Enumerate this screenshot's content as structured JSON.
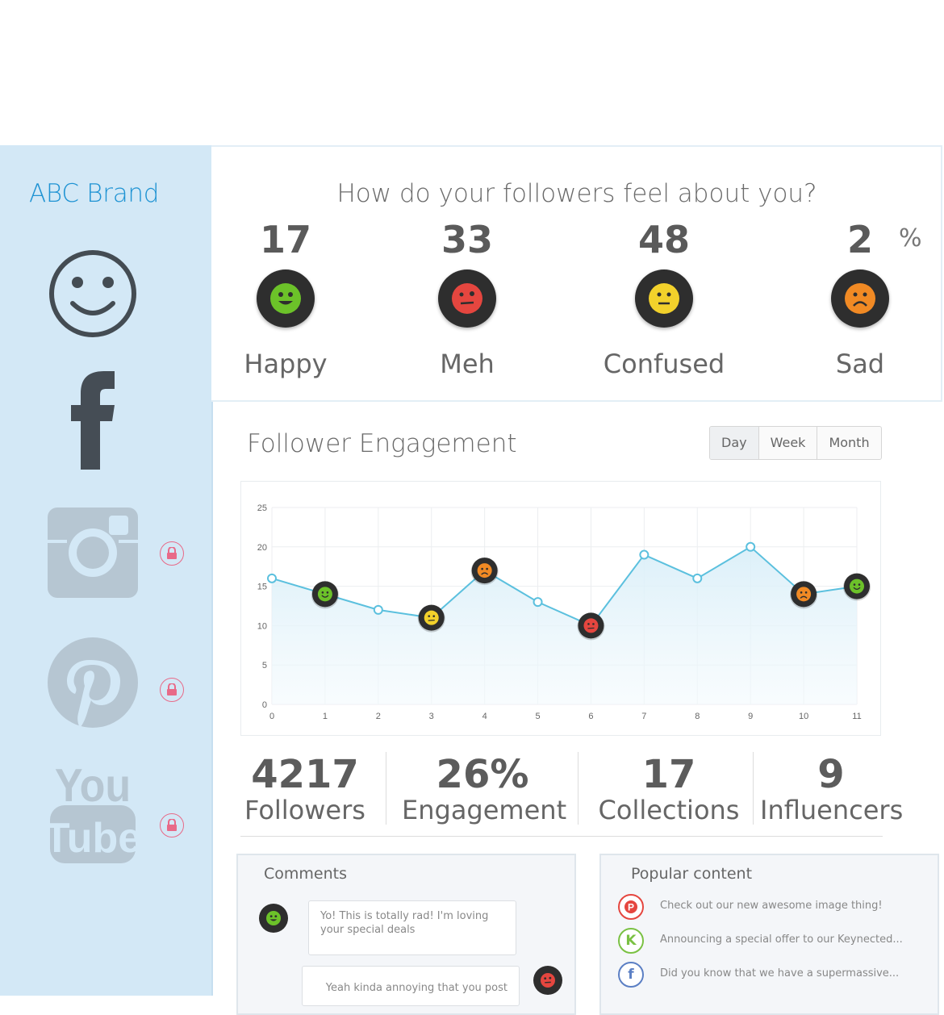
{
  "brand": {
    "name": "ABC Brand"
  },
  "sidebar": {
    "networks": [
      {
        "name": "smiley-icon",
        "locked": false
      },
      {
        "name": "facebook-icon",
        "locked": false
      },
      {
        "name": "instagram-icon",
        "locked": true
      },
      {
        "name": "pinterest-icon",
        "locked": true
      },
      {
        "name": "youtube-icon",
        "locked": true,
        "text_top": "You",
        "text_bottom": "Tube"
      }
    ]
  },
  "sentiment": {
    "question": "How do your followers feel about you?",
    "unit": "%",
    "moods": [
      {
        "count": "17",
        "label": "Happy",
        "color": "#6cc229"
      },
      {
        "count": "33",
        "label": "Meh",
        "color": "#e5463f"
      },
      {
        "count": "48",
        "label": "Confused",
        "color": "#f2d12b"
      },
      {
        "count": "2",
        "label": "Sad",
        "color": "#f18a24"
      }
    ]
  },
  "engagement": {
    "title": "Follower Engagement",
    "ranges": [
      "Day",
      "Week",
      "Month"
    ],
    "selected_range": "Day"
  },
  "chart_data": {
    "type": "area",
    "x": [
      0,
      1,
      2,
      3,
      4,
      5,
      6,
      7,
      8,
      9,
      10,
      11
    ],
    "values": [
      16,
      14,
      12,
      11,
      17,
      13,
      10,
      19,
      16,
      20,
      14,
      15
    ],
    "markers": [
      null,
      "happy",
      null,
      "confused",
      "sad",
      null,
      "meh",
      null,
      null,
      null,
      "sad",
      "happy"
    ],
    "xlim": [
      0,
      11
    ],
    "ylim": [
      0,
      25
    ],
    "yticks": [
      0,
      5,
      10,
      15,
      20,
      25
    ],
    "grid": true,
    "line_color": "#5bc0de"
  },
  "stats": [
    {
      "value": "4217",
      "label": "Followers"
    },
    {
      "value": "26%",
      "label": "Engagement"
    },
    {
      "value": "17",
      "label": "Collections"
    },
    {
      "value": "9",
      "label": "Influencers"
    }
  ],
  "comments": {
    "title": "Comments",
    "items": [
      {
        "text": "Yo! This is totally rad! I'm loving your special deals",
        "mood_color": "#6cc229"
      },
      {
        "text": "Yeah kinda annoying that you post",
        "mood_color": "#e5463f"
      }
    ]
  },
  "popular": {
    "title": "Popular content",
    "items": [
      {
        "icon": "pinterest-icon",
        "glyph": "P",
        "color": "#e5463f",
        "text": "Check out our new awesome image thing!"
      },
      {
        "icon": "keynected-icon",
        "glyph": "K",
        "color": "#7ac143",
        "text": "Announcing a special offer to our Keynected..."
      },
      {
        "icon": "facebook-icon",
        "glyph": "f",
        "color": "#5b7fc4",
        "text": "Did you know that we have a supermassive..."
      }
    ]
  }
}
